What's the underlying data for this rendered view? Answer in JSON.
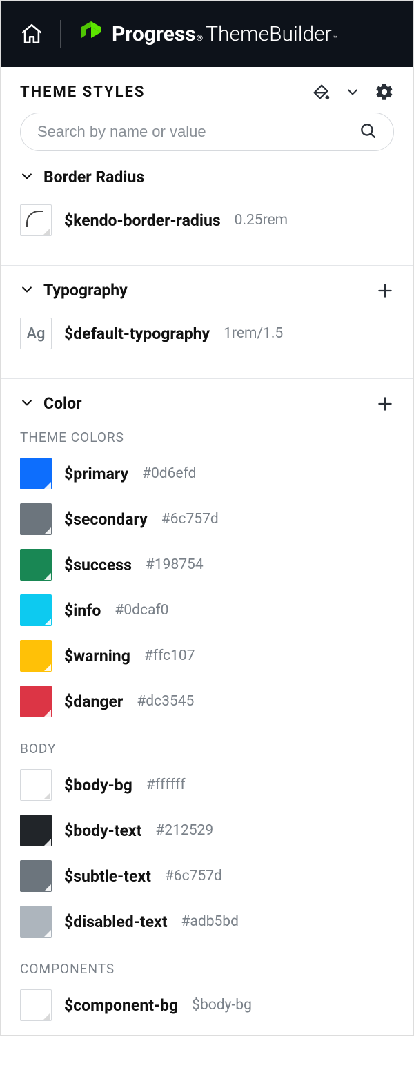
{
  "header": {
    "brand_word1": "Progress",
    "brand_word2": "ThemeBuilder",
    "panel_title": "THEME STYLES"
  },
  "search": {
    "placeholder": "Search by name or value"
  },
  "sections": {
    "border_radius": {
      "title": "Border Radius",
      "item": {
        "name": "$kendo-border-radius",
        "value": "0.25rem"
      }
    },
    "typography": {
      "title": "Typography",
      "item": {
        "name": "$default-typography",
        "value": "1rem/1.5"
      }
    },
    "color": {
      "title": "Color"
    }
  },
  "color_groups": {
    "theme_label": "THEME COLORS",
    "theme": [
      {
        "name": "$primary",
        "value": "#0d6efd",
        "swatch": "#0d6efd"
      },
      {
        "name": "$secondary",
        "value": "#6c757d",
        "swatch": "#6c757d"
      },
      {
        "name": "$success",
        "value": "#198754",
        "swatch": "#198754"
      },
      {
        "name": "$info",
        "value": "#0dcaf0",
        "swatch": "#0dcaf0"
      },
      {
        "name": "$warning",
        "value": "#ffc107",
        "swatch": "#ffc107"
      },
      {
        "name": "$danger",
        "value": "#dc3545",
        "swatch": "#dc3545"
      }
    ],
    "body_label": "BODY",
    "body": [
      {
        "name": "$body-bg",
        "value": "#ffffff",
        "swatch": "#ffffff",
        "border": true
      },
      {
        "name": "$body-text",
        "value": "#212529",
        "swatch": "#212529"
      },
      {
        "name": "$subtle-text",
        "value": "#6c757d",
        "swatch": "#6c757d"
      },
      {
        "name": "$disabled-text",
        "value": "#adb5bd",
        "swatch": "#adb5bd"
      }
    ],
    "components_label": "COMPONENTS",
    "components": [
      {
        "name": "$component-bg",
        "value": "$body-bg",
        "swatch": "#ffffff",
        "border": true
      }
    ]
  }
}
